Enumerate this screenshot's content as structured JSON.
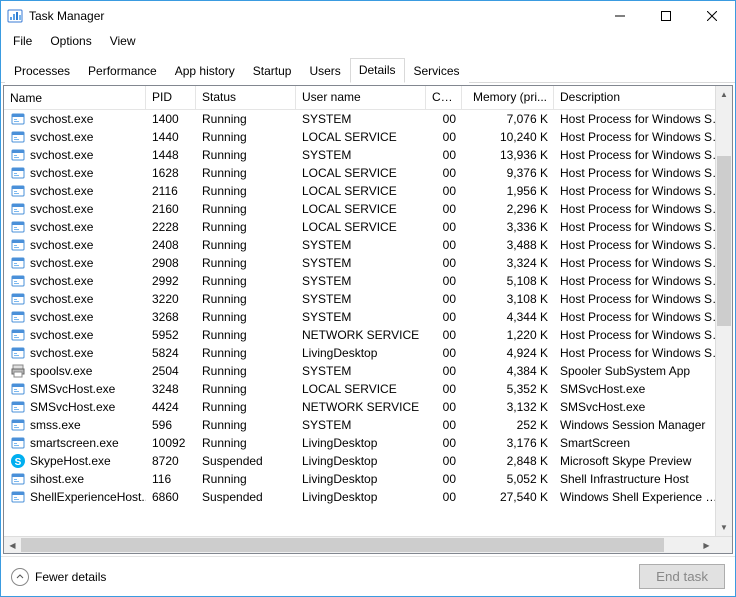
{
  "window": {
    "title": "Task Manager"
  },
  "menu": {
    "items": [
      "File",
      "Options",
      "View"
    ]
  },
  "tabs": {
    "items": [
      "Processes",
      "Performance",
      "App history",
      "Startup",
      "Users",
      "Details",
      "Services"
    ],
    "active": 5
  },
  "columns": {
    "name": "Name",
    "pid": "PID",
    "status": "Status",
    "user": "User name",
    "cpu": "CPU",
    "mem": "Memory (pri...",
    "desc": "Description"
  },
  "footer": {
    "fewer_label": "Fewer details",
    "end_task_label": "End task"
  },
  "processes": [
    {
      "icon": "exe",
      "name": "svchost.exe",
      "pid": "1400",
      "status": "Running",
      "user": "SYSTEM",
      "cpu": "00",
      "mem": "7,076 K",
      "desc": "Host Process for Windows Serv"
    },
    {
      "icon": "exe",
      "name": "svchost.exe",
      "pid": "1440",
      "status": "Running",
      "user": "LOCAL SERVICE",
      "cpu": "00",
      "mem": "10,240 K",
      "desc": "Host Process for Windows Serv"
    },
    {
      "icon": "exe",
      "name": "svchost.exe",
      "pid": "1448",
      "status": "Running",
      "user": "SYSTEM",
      "cpu": "00",
      "mem": "13,936 K",
      "desc": "Host Process for Windows Serv"
    },
    {
      "icon": "exe",
      "name": "svchost.exe",
      "pid": "1628",
      "status": "Running",
      "user": "LOCAL SERVICE",
      "cpu": "00",
      "mem": "9,376 K",
      "desc": "Host Process for Windows Serv"
    },
    {
      "icon": "exe",
      "name": "svchost.exe",
      "pid": "2116",
      "status": "Running",
      "user": "LOCAL SERVICE",
      "cpu": "00",
      "mem": "1,956 K",
      "desc": "Host Process for Windows Serv"
    },
    {
      "icon": "exe",
      "name": "svchost.exe",
      "pid": "2160",
      "status": "Running",
      "user": "LOCAL SERVICE",
      "cpu": "00",
      "mem": "2,296 K",
      "desc": "Host Process for Windows Serv"
    },
    {
      "icon": "exe",
      "name": "svchost.exe",
      "pid": "2228",
      "status": "Running",
      "user": "LOCAL SERVICE",
      "cpu": "00",
      "mem": "3,336 K",
      "desc": "Host Process for Windows Serv"
    },
    {
      "icon": "exe",
      "name": "svchost.exe",
      "pid": "2408",
      "status": "Running",
      "user": "SYSTEM",
      "cpu": "00",
      "mem": "3,488 K",
      "desc": "Host Process for Windows Serv"
    },
    {
      "icon": "exe",
      "name": "svchost.exe",
      "pid": "2908",
      "status": "Running",
      "user": "SYSTEM",
      "cpu": "00",
      "mem": "3,324 K",
      "desc": "Host Process for Windows Serv"
    },
    {
      "icon": "exe",
      "name": "svchost.exe",
      "pid": "2992",
      "status": "Running",
      "user": "SYSTEM",
      "cpu": "00",
      "mem": "5,108 K",
      "desc": "Host Process for Windows Serv"
    },
    {
      "icon": "exe",
      "name": "svchost.exe",
      "pid": "3220",
      "status": "Running",
      "user": "SYSTEM",
      "cpu": "00",
      "mem": "3,108 K",
      "desc": "Host Process for Windows Serv"
    },
    {
      "icon": "exe",
      "name": "svchost.exe",
      "pid": "3268",
      "status": "Running",
      "user": "SYSTEM",
      "cpu": "00",
      "mem": "4,344 K",
      "desc": "Host Process for Windows Serv"
    },
    {
      "icon": "exe",
      "name": "svchost.exe",
      "pid": "5952",
      "status": "Running",
      "user": "NETWORK SERVICE",
      "cpu": "00",
      "mem": "1,220 K",
      "desc": "Host Process for Windows Serv"
    },
    {
      "icon": "exe",
      "name": "svchost.exe",
      "pid": "5824",
      "status": "Running",
      "user": "LivingDesktop",
      "cpu": "00",
      "mem": "4,924 K",
      "desc": "Host Process for Windows Serv"
    },
    {
      "icon": "printer",
      "name": "spoolsv.exe",
      "pid": "2504",
      "status": "Running",
      "user": "SYSTEM",
      "cpu": "00",
      "mem": "4,384 K",
      "desc": "Spooler SubSystem App"
    },
    {
      "icon": "exe",
      "name": "SMSvcHost.exe",
      "pid": "3248",
      "status": "Running",
      "user": "LOCAL SERVICE",
      "cpu": "00",
      "mem": "5,352 K",
      "desc": "SMSvcHost.exe"
    },
    {
      "icon": "exe",
      "name": "SMSvcHost.exe",
      "pid": "4424",
      "status": "Running",
      "user": "NETWORK SERVICE",
      "cpu": "00",
      "mem": "3,132 K",
      "desc": "SMSvcHost.exe"
    },
    {
      "icon": "exe",
      "name": "smss.exe",
      "pid": "596",
      "status": "Running",
      "user": "SYSTEM",
      "cpu": "00",
      "mem": "252 K",
      "desc": "Windows Session Manager"
    },
    {
      "icon": "exe",
      "name": "smartscreen.exe",
      "pid": "10092",
      "status": "Running",
      "user": "LivingDesktop",
      "cpu": "00",
      "mem": "3,176 K",
      "desc": "SmartScreen"
    },
    {
      "icon": "skype",
      "name": "SkypeHost.exe",
      "pid": "8720",
      "status": "Suspended",
      "user": "LivingDesktop",
      "cpu": "00",
      "mem": "2,848 K",
      "desc": "Microsoft Skype Preview"
    },
    {
      "icon": "exe",
      "name": "sihost.exe",
      "pid": "116",
      "status": "Running",
      "user": "LivingDesktop",
      "cpu": "00",
      "mem": "5,052 K",
      "desc": "Shell Infrastructure Host"
    },
    {
      "icon": "exe",
      "name": "ShellExperienceHost....",
      "pid": "6860",
      "status": "Suspended",
      "user": "LivingDesktop",
      "cpu": "00",
      "mem": "27,540 K",
      "desc": "Windows Shell Experience Hos"
    }
  ]
}
